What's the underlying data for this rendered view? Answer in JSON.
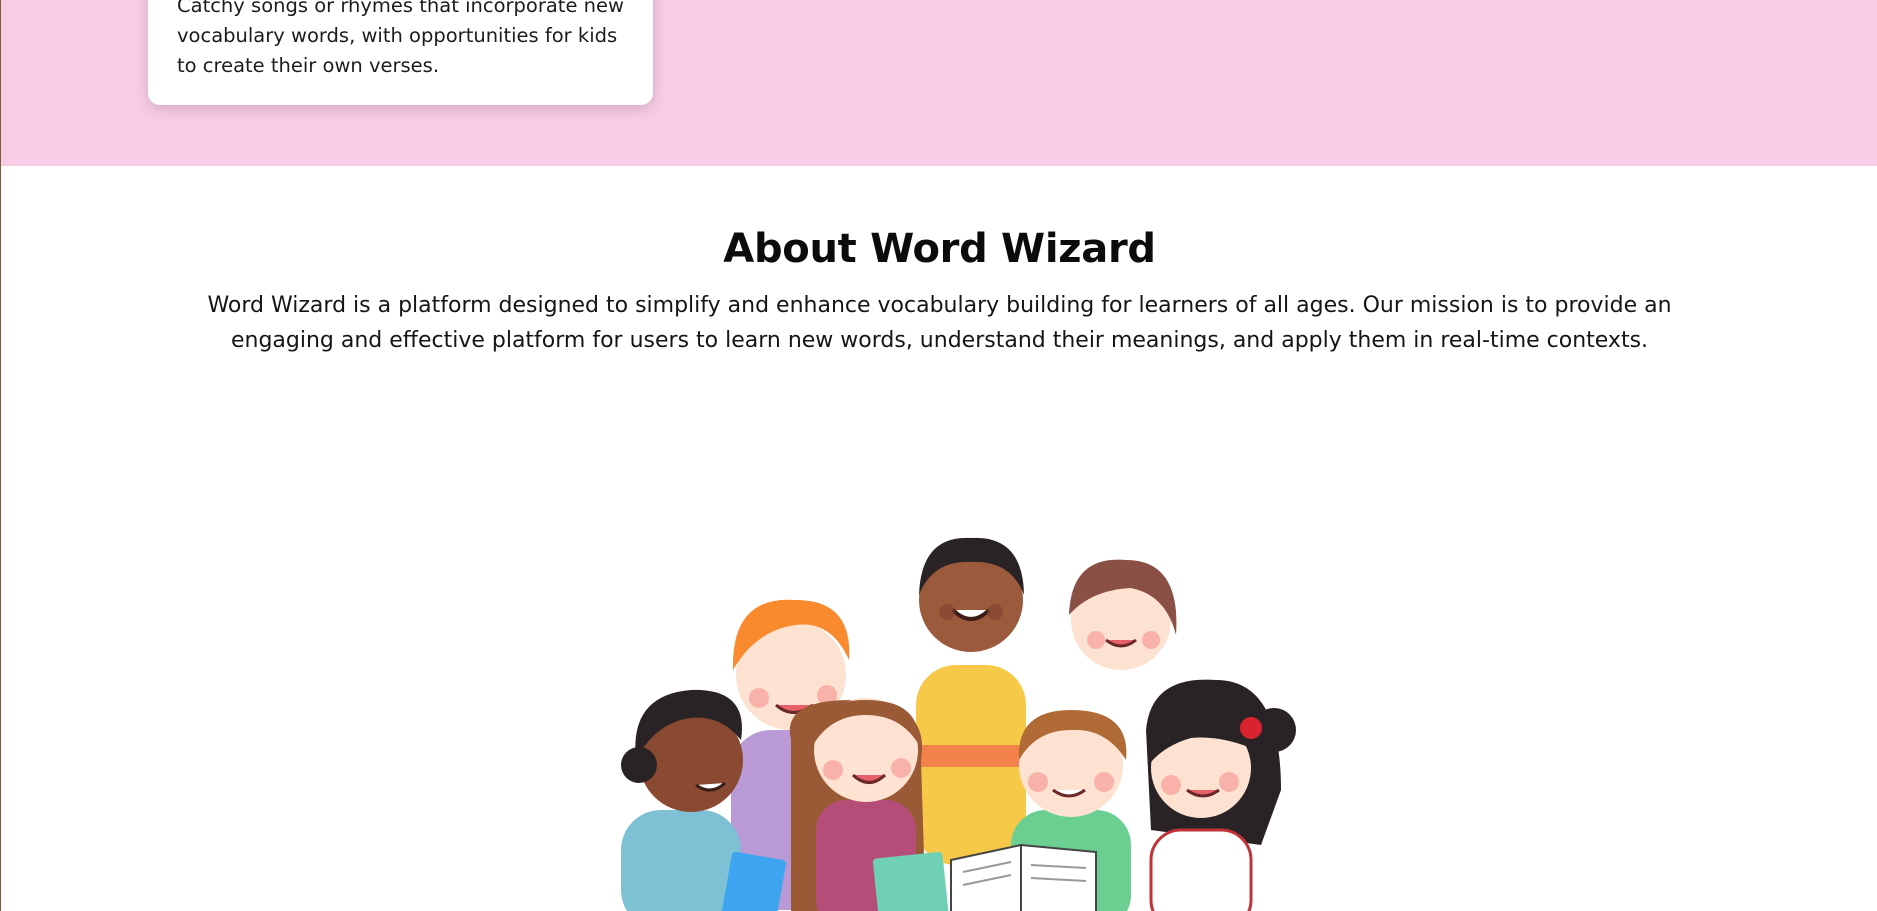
{
  "feature_card": {
    "description": "Catchy songs or rhymes that incorporate new vocabulary words, with opportunities for kids to create their own verses."
  },
  "about": {
    "title": "About Word Wizard",
    "text": "Word Wizard is a platform designed to simplify and enhance vocabulary building for learners of all ages. Our mission is to provide an engaging and effective platform for users to learn new words, understand their meanings, and apply them in real-time contexts."
  },
  "illustration": {
    "subject": "group of children reading books together"
  },
  "colors": {
    "band_background": "#f9cce6",
    "page_background": "#ffffff",
    "heading": "#0b0b0b"
  }
}
